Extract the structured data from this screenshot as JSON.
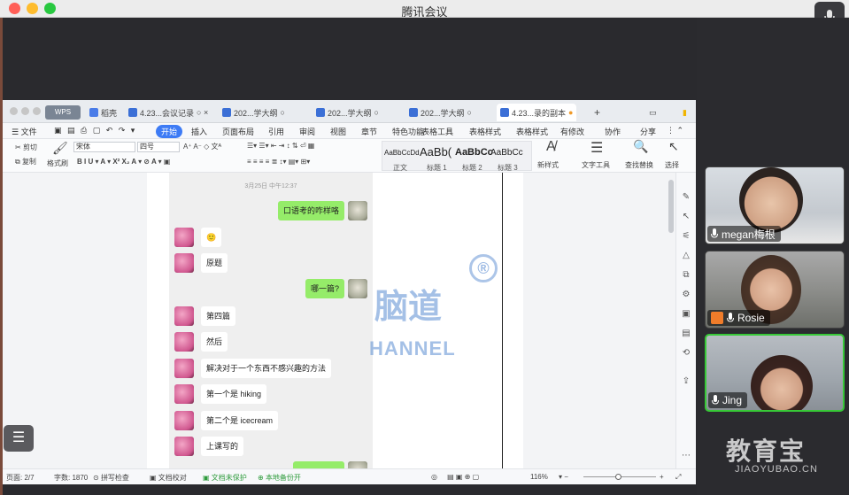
{
  "app": {
    "title": "腾讯会议"
  },
  "participants": [
    {
      "name": "megan梅根"
    },
    {
      "name": "Rosie"
    },
    {
      "name": "Jing"
    }
  ],
  "watermark": {
    "brand": "教育宝",
    "site": "JIAOYUBAO.CN",
    "doc_text": "脑道",
    "doc_text2": "HANNEL",
    "registered": "®"
  },
  "wps": {
    "logo": "WPS",
    "tabs": [
      {
        "label": "稻壳"
      },
      {
        "label": "4.23...会议记录"
      },
      {
        "label": "202...学大纲"
      },
      {
        "label": "202...学大纲"
      },
      {
        "label": "202...学大纲"
      },
      {
        "label": "4.23...录的副本"
      }
    ],
    "menu": {
      "file": "文件",
      "items": [
        "开始",
        "插入",
        "页面布局",
        "引用",
        "审阅",
        "视图",
        "章节",
        "特色功能",
        "表格工具",
        "表格样式"
      ],
      "right": [
        "有修改",
        "协作",
        "分享"
      ]
    },
    "ribbon": {
      "cut": "剪切",
      "copy": "复制",
      "format_painter": "格式刷",
      "font": "宋体",
      "size": "四号",
      "styles": [
        {
          "sample": "AaBbCcDd",
          "label": "正文"
        },
        {
          "sample": "AaBb(",
          "label": "标题 1"
        },
        {
          "sample": "AaBbCc",
          "label": "标题 2"
        },
        {
          "sample": "AaBbCc",
          "label": "标题 3"
        }
      ],
      "new_style": "新样式",
      "text_tools": "文字工具",
      "find_replace": "查找替换",
      "select": "选择"
    },
    "chat": {
      "timestamp": "3月25日 中午12:37",
      "messages": [
        {
          "side": "right",
          "text": "口语考的咋样咯"
        },
        {
          "side": "left",
          "text": "🙂"
        },
        {
          "side": "left",
          "text": "原题"
        },
        {
          "side": "right",
          "text": "哪一篇?"
        },
        {
          "side": "left",
          "text": "第四篇"
        },
        {
          "side": "left",
          "text": "然后"
        },
        {
          "side": "left",
          "text": "解决对于一个东西不感兴趣的方法"
        },
        {
          "side": "left",
          "text": "第一个是 hiking"
        },
        {
          "side": "left",
          "text": "第二个是 icecream"
        },
        {
          "side": "left",
          "text": "上课写的"
        }
      ]
    },
    "status": {
      "page": "页面: 2/7",
      "words": "字数: 1870",
      "spell": "拼写检查",
      "proof": "文档校对",
      "unsaved": "文档未保护",
      "backup": "本地备份开",
      "zoom": "116%"
    }
  }
}
